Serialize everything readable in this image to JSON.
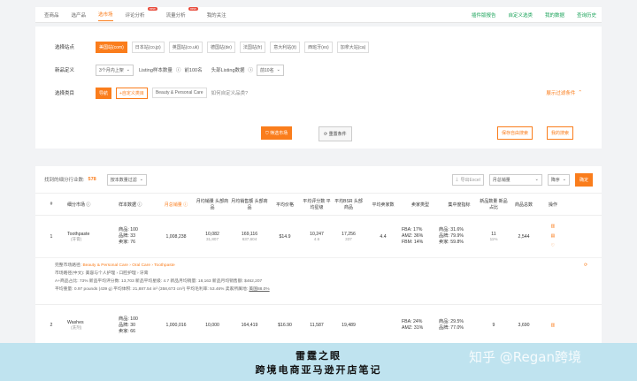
{
  "nav": {
    "tabs": [
      "查商品",
      "选产品",
      "选市场",
      "评论分析",
      "流量分析",
      "我的关注"
    ],
    "new_badge": "new",
    "links": [
      "插件版报告",
      "自定义选类",
      "我的数据",
      "查询历史"
    ]
  },
  "filters": {
    "site_label": "选择站点",
    "sites": [
      "美国站(com)",
      "日本站(co.jp)",
      "英国站(co.uk)",
      "德国站(de)",
      "法国站(fr)",
      "意大利站(it)",
      "西班牙(es)",
      "加拿大站(ca)"
    ],
    "def_label": "新品定义",
    "def_value": "3个月内上架",
    "listing_sample_label": "Listing样本数量",
    "listing_sample_value": "前100名",
    "head_listing_label": "头部Listing数据",
    "head_listing_value": "前10名",
    "category_label": "选择类目",
    "cat_btn1": "导航",
    "cat_btn2": "+自定义类目",
    "cat_path": "Beauty & Personal Care",
    "cat_link": "如何自定义品类?",
    "more_filters": "展示过滤条件",
    "btn_filter": "筛选市场",
    "btn_reset": "重置条件",
    "btn_save": "保存自由搜索",
    "btn_mine": "我的搜索"
  },
  "results": {
    "count_label": "找到的细分行业数:",
    "count_value": "578",
    "sort_select": "按本数量过滤",
    "export": "导出Excel",
    "sort2": "月总销量",
    "order": "降序",
    "confirm": "确定",
    "headers": [
      "#",
      "细分市场",
      "样本数据",
      "月总销量",
      "月均销量 头部商品",
      "月均销售额 头部商品",
      "平均价格",
      "平均评分数 平均星级",
      "平均BSR 头部商品",
      "平均卖家数",
      "卖家类型",
      "集中度指标",
      "新品数量 新品占比",
      "商品总数",
      "操作"
    ],
    "rows": [
      {
        "idx": "1",
        "name": "Toothpaste",
        "name_cn": "(牙膏)",
        "sample": [
          "商品: 100",
          "品牌: 33",
          "卖家: 76"
        ],
        "total_sales": "1,008,238",
        "avg_sales": "10,082",
        "avg_sales_head": "31,807",
        "avg_rev": "169,116",
        "avg_rev_head": "637,604",
        "price": "$14.9",
        "ratings": "10,247",
        "stars": "4.6",
        "bsr": "17,256",
        "bsr_head": "337",
        "sellers": "4.4",
        "seller_type": [
          "FBA: 17%",
          "AMZ: 36%",
          "FBM: 14%"
        ],
        "conc": [
          "商品: 31.6%",
          "品牌: 79.9%",
          "卖家: 59.8%"
        ],
        "new_count": "11",
        "new_pct": "11%",
        "total": "2,544"
      },
      {
        "idx": "2",
        "name": "Washes",
        "name_cn": "(洗剂)",
        "sample": [
          "商品: 100",
          "品牌: 30",
          "卖家: 66"
        ],
        "total_sales": "1,000,016",
        "avg_sales": "10,000",
        "avg_sales_head": "",
        "avg_rev": "164,419",
        "avg_rev_head": "",
        "price": "$16.90",
        "ratings": "11,587",
        "stars": "",
        "bsr": "19,489",
        "bsr_head": "",
        "sellers": "",
        "seller_type": [
          "FBA: 24%",
          "AMZ: 31%",
          ""
        ],
        "conc": [
          "商品: 29.5%",
          "品牌: 77.0%",
          ""
        ],
        "new_count": "9",
        "new_pct": "",
        "total": "3,690"
      }
    ],
    "detail": {
      "path_label": "完整市场路径:",
      "path_value": "Beauty & Personal Care › Oral Care › Toothpaste",
      "cn_path": "市场路径(中文): 美容与个人护理 › 口腔护理 › 牙膏",
      "line3": "A+商品占比: 73%    新品平均评分数: 13,703    新品平均星级: 4.7    新品月均销量: 18,163    新品月均销售额: $462,207",
      "line4_a": "平均重量: 0.97 pounds (439 g)    平均体积: 21,887.54 in³ (358,673 cm³)    平均毛利率: 53.46%    卖家所属地: ",
      "line4_b": "美国88.0%"
    }
  },
  "banner": {
    "line1": "雷霆之眼",
    "line2": "跨境电商亚马逊开店笔记",
    "watermark": "知乎 @Regan跨境"
  },
  "colors": {
    "accent": "#fa7d1c",
    "link_green": "#1ba35a",
    "banner": "#bfe3ef"
  }
}
